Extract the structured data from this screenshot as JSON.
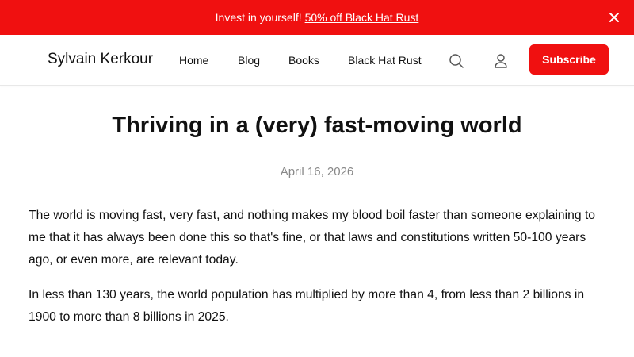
{
  "promo": {
    "text": "Invest in yourself!",
    "link_text": "50% off Black Hat Rust",
    "background": "#f01010",
    "close_icon": "close-icon"
  },
  "header": {
    "site_title": "Sylvain Kerkour",
    "nav": [
      "Home",
      "Blog",
      "Books",
      "Black Hat Rust"
    ],
    "search_icon": "search-icon",
    "account_icon": "user-icon",
    "subscribe_label": "Subscribe",
    "accent": "#f01010"
  },
  "post": {
    "title": "Thriving in a (very) fast-moving world",
    "date": "April 16, 2026",
    "paragraphs": [
      "The world is moving fast, very fast, and nothing makes my blood boil faster than someone explaining to me that it has always been done this so that's fine, or that laws and constitutions written 50-100 years ago, or even more, are relevant today.",
      "In less than 130 years, the world population has multiplied by more than 4, from less than 2 billions in 1900 to more than 8 billions in 2025."
    ]
  }
}
